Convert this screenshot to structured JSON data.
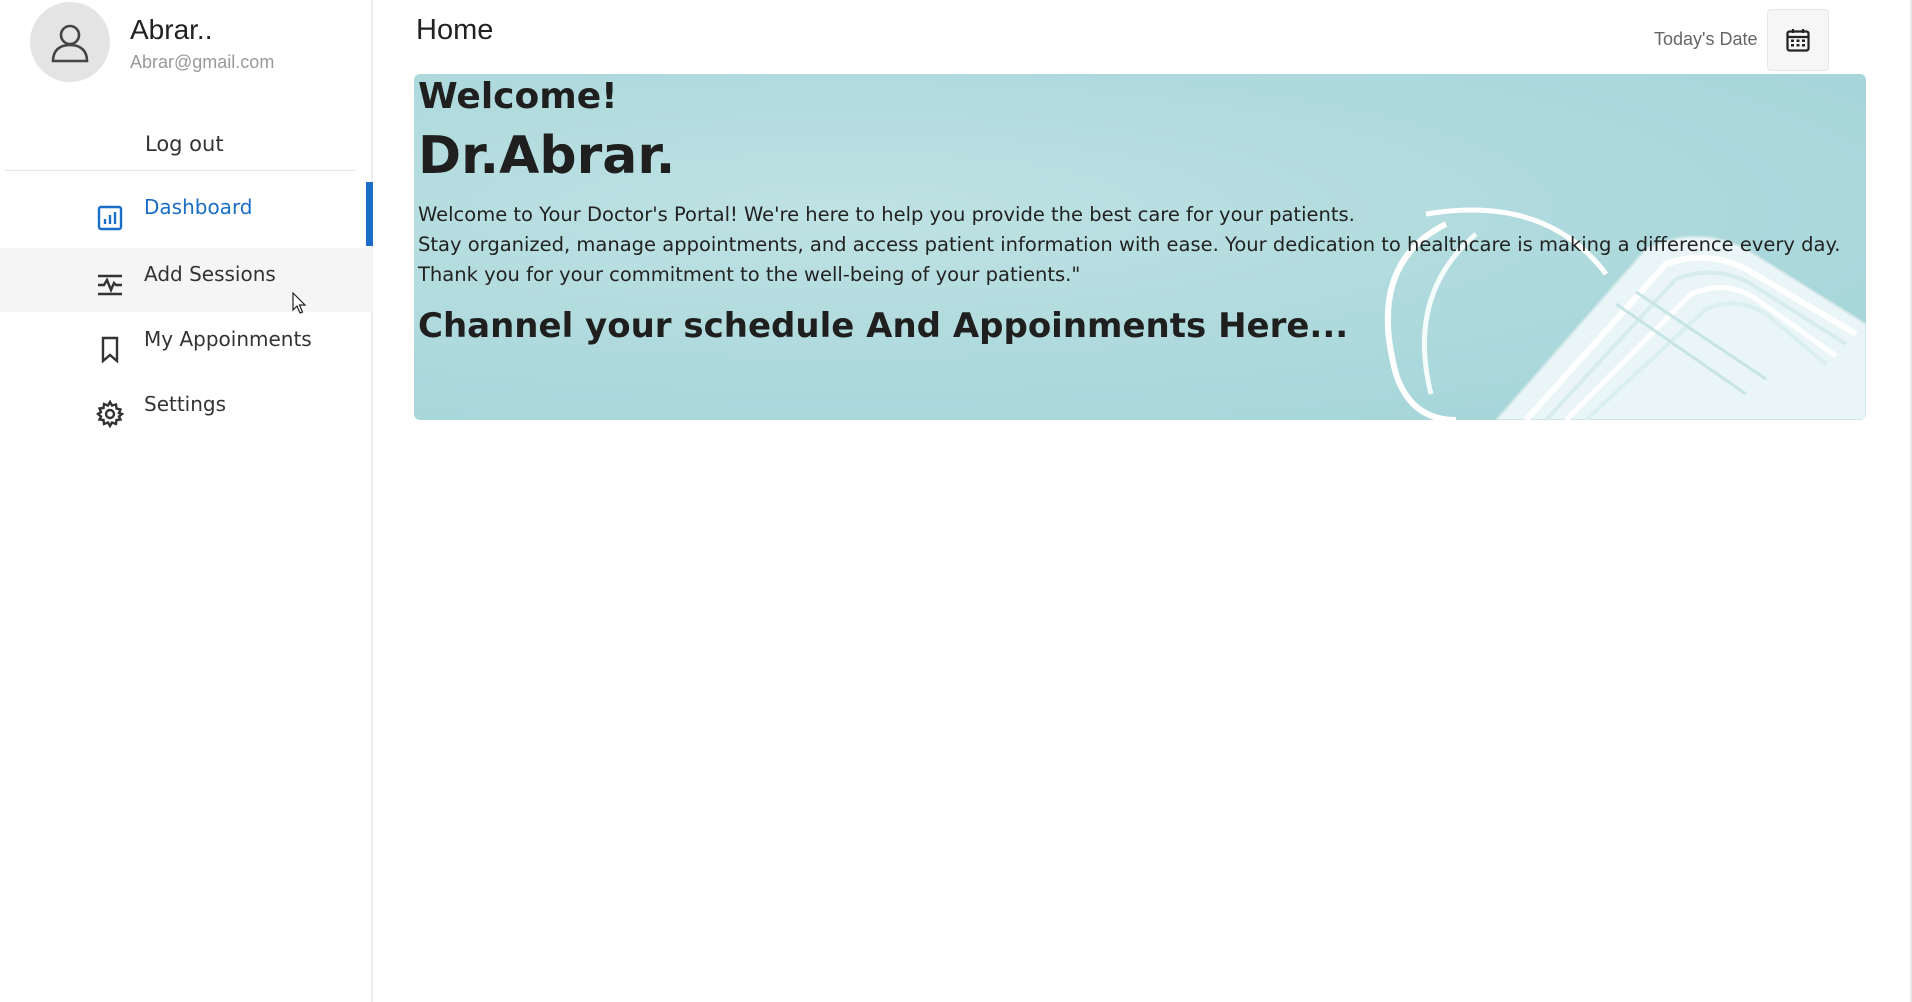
{
  "profile": {
    "name": "Abrar..",
    "email": "Abrar@gmail.com",
    "logout_label": "Log out"
  },
  "sidebar": {
    "items": [
      {
        "label": "Dashboard",
        "icon": "dashboard-icon",
        "active": true
      },
      {
        "label": "Add Sessions",
        "icon": "sessions-icon",
        "active": false
      },
      {
        "label": "My Appoinments",
        "icon": "bookmark-icon",
        "active": false
      },
      {
        "label": "Settings",
        "icon": "gear-icon",
        "active": false
      }
    ]
  },
  "header": {
    "title": "Home",
    "date_label": "Today's Date",
    "calendar_icon": "calendar-icon"
  },
  "banner": {
    "greeting": "Welcome!",
    "doctor_name": "Dr.Abrar.",
    "intro_line1": "Welcome to Your Doctor's Portal! We're here to help you provide the best care for your patients.",
    "intro_line2": "Stay organized, manage appointments, and access patient information with ease. Your dedication to healthcare is making a difference every day. Thank you for your commitment to the well-being of your patients.\"",
    "cta_heading": "Channel your schedule And Appoinments Here...",
    "background_image": "face-masks-on-teal-background"
  },
  "colors": {
    "accent": "#1a6ec8",
    "banner_bg": "#afdadd",
    "text": "#222222"
  }
}
